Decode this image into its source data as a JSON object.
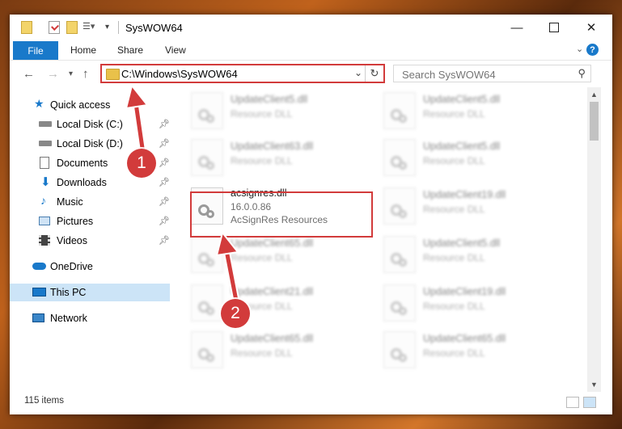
{
  "window": {
    "title": "SysWOW64"
  },
  "ribbon": {
    "file": "File",
    "home": "Home",
    "share": "Share",
    "view": "View"
  },
  "address": {
    "path": "C:\\Windows\\SysWOW64"
  },
  "search": {
    "placeholder": "Search SysWOW64"
  },
  "nav": {
    "quick_access": "Quick access",
    "items": [
      "Local Disk (C:)",
      "Local Disk (D:)",
      "Documents",
      "Downloads",
      "Music",
      "Pictures",
      "Videos"
    ],
    "onedrive": "OneDrive",
    "this_pc": "This PC",
    "network": "Network"
  },
  "files": {
    "left": [
      {
        "name": "UpdateClient5.dll",
        "type": "Resource DLL"
      },
      {
        "name": "UpdateClient63.dll",
        "type": "Resource DLL"
      },
      {
        "name": "acsignres.dll",
        "version": "16.0.0.86",
        "type": "AcSignRes Resources"
      },
      {
        "name": "UpdateClient65.dll",
        "type": "Resource DLL"
      },
      {
        "name": "UpdateClient21.dll",
        "type": "Resource DLL"
      },
      {
        "name": "UpdateClient65.dll",
        "type": "Resource DLL"
      }
    ],
    "right": [
      {
        "name": "UpdateClient5.dll",
        "type": "Resource DLL"
      },
      {
        "name": "UpdateClient5.dll",
        "type": "Resource DLL"
      },
      {
        "name": "UpdateClient19.dll",
        "type": "Resource DLL"
      },
      {
        "name": "UpdateClient5.dll",
        "type": "Resource DLL"
      },
      {
        "name": "UpdateClient19.dll",
        "type": "Resource DLL"
      },
      {
        "name": "UpdateClient65.dll",
        "type": "Resource DLL"
      }
    ]
  },
  "status": {
    "count": "115 items"
  },
  "annotations": {
    "marker1": "1",
    "marker2": "2"
  },
  "colors": {
    "accent": "#1979ca",
    "annotation": "#d23b3b"
  }
}
